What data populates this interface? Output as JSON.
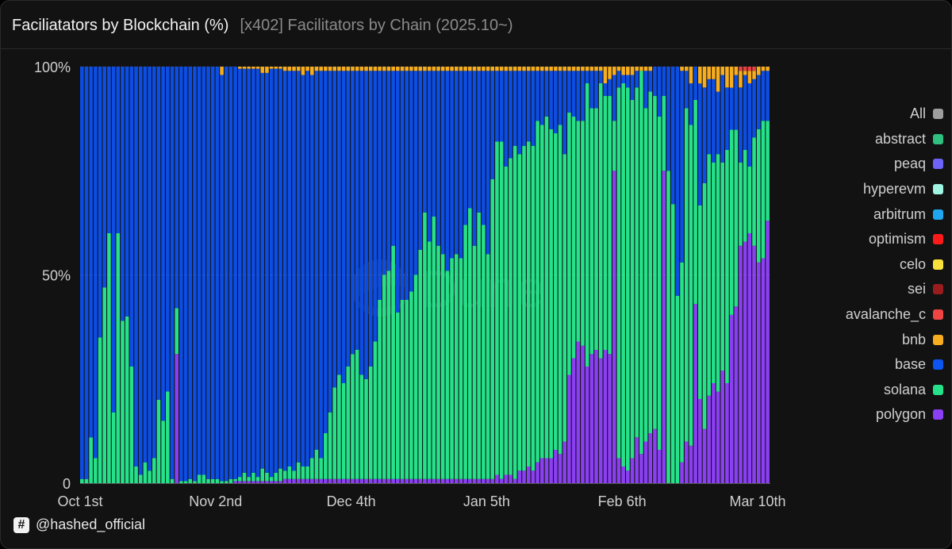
{
  "header": {
    "title": "Faciliatators by Blockchain (%)",
    "subtitle": "[x402] Facilitators by Chain (2025.10~)"
  },
  "footer": {
    "handle": "@hashed_official",
    "icon": "hash-icon"
  },
  "watermark": {
    "text": "Dune",
    "icon": "dune-logo-icon"
  },
  "colors": {
    "background": "#121212",
    "polygon": "#8b3ff2",
    "solana": "#25e28a",
    "base": "#0c4de3",
    "bnb": "#f6ad1f",
    "avalanche_c": "#e84142",
    "optimism": "#ff0420",
    "abstract": "#1bb37a"
  },
  "legend": {
    "items": [
      {
        "label": "All",
        "color": "#9e9e9e"
      },
      {
        "label": "abstract",
        "color": "#2fbf7f"
      },
      {
        "label": "peaq",
        "color": "#6d63f6"
      },
      {
        "label": "hyperevm",
        "color": "#9ff5e1"
      },
      {
        "label": "arbitrum",
        "color": "#1fa6ee"
      },
      {
        "label": "optimism",
        "color": "#ff1a1a"
      },
      {
        "label": "celo",
        "color": "#f7e13a"
      },
      {
        "label": "sei",
        "color": "#9b1c1c"
      },
      {
        "label": "avalanche_c",
        "color": "#ef4444"
      },
      {
        "label": "bnb",
        "color": "#f6ad1f"
      },
      {
        "label": "base",
        "color": "#0c55ee"
      },
      {
        "label": "solana",
        "color": "#25e28a"
      },
      {
        "label": "polygon",
        "color": "#8b3ff2"
      }
    ]
  },
  "chart_data": {
    "type": "bar",
    "stacked": true,
    "normalized": true,
    "x_start": "2025-10-01",
    "x_end": "2026-03-13",
    "x_ticks": [
      {
        "date": "2025-10-01",
        "label": "Oct 1st"
      },
      {
        "date": "2025-11-02",
        "label": "Nov 2nd"
      },
      {
        "date": "2025-12-04",
        "label": "Dec 4th"
      },
      {
        "date": "2026-01-05",
        "label": "Jan 5th"
      },
      {
        "date": "2026-02-06",
        "label": "Feb 6th"
      },
      {
        "date": "2026-03-10",
        "label": "Mar 10th"
      }
    ],
    "y_ticks": [
      {
        "value": 0,
        "label": "0"
      },
      {
        "value": 50,
        "label": "50%"
      },
      {
        "value": 100,
        "label": "100%"
      }
    ],
    "ylim": [
      0,
      100
    ],
    "series_order": [
      "polygon",
      "solana",
      "base",
      "bnb",
      "avalanche_c"
    ],
    "series_colors": [
      "#8b3ff2",
      "#25e28a",
      "#0c4de3",
      "#f6ad1f",
      "#e84142"
    ],
    "points": [
      [
        0,
        0,
        1,
        99,
        0,
        0
      ],
      [
        1,
        0,
        1,
        99,
        0,
        0
      ],
      [
        2,
        0,
        11,
        89,
        0,
        0
      ],
      [
        3,
        0,
        6,
        94,
        0,
        0
      ],
      [
        4,
        0,
        35,
        65,
        0,
        0
      ],
      [
        5,
        0,
        47,
        53,
        0,
        0
      ],
      [
        6,
        0,
        60,
        40,
        0,
        0
      ],
      [
        7,
        0,
        17,
        83,
        0,
        0
      ],
      [
        8,
        0,
        60,
        40,
        0,
        0
      ],
      [
        9,
        0,
        39,
        61,
        0,
        0
      ],
      [
        10,
        0,
        40,
        60,
        0,
        0
      ],
      [
        11,
        0,
        28,
        72,
        0,
        0
      ],
      [
        12,
        0,
        4,
        96,
        0,
        0
      ],
      [
        13,
        0,
        2,
        98,
        0,
        0
      ],
      [
        14,
        0,
        5,
        95,
        0,
        0
      ],
      [
        15,
        0,
        3,
        97,
        0,
        0
      ],
      [
        16,
        0,
        6,
        94,
        0,
        0
      ],
      [
        17,
        0,
        20,
        80,
        0,
        0
      ],
      [
        18,
        0,
        15,
        85,
        0,
        0
      ],
      [
        19,
        0,
        22,
        78,
        0,
        0
      ],
      [
        20,
        0,
        1,
        99,
        0,
        0
      ],
      [
        21,
        31,
        11,
        58,
        0,
        0
      ],
      [
        22,
        0,
        0.5,
        99,
        0,
        0
      ],
      [
        23,
        0,
        0.5,
        99,
        0,
        0
      ],
      [
        24,
        0,
        1,
        99,
        0,
        0
      ],
      [
        25,
        0,
        0.5,
        99,
        0,
        0
      ],
      [
        26,
        0,
        2,
        98,
        0,
        0
      ],
      [
        27,
        0,
        2,
        98,
        0,
        0
      ],
      [
        28,
        0,
        1,
        99,
        0,
        0
      ],
      [
        29,
        0,
        1,
        99,
        0,
        0
      ],
      [
        30,
        0,
        1,
        99,
        0,
        0
      ],
      [
        31,
        0,
        0.5,
        98,
        2,
        0
      ],
      [
        32,
        0,
        0.5,
        99,
        0,
        0
      ],
      [
        33,
        0,
        1,
        99,
        0,
        0
      ],
      [
        34,
        0.5,
        0.5,
        99,
        0,
        0
      ],
      [
        35,
        0.5,
        1,
        98,
        0.5,
        0
      ],
      [
        36,
        0.5,
        2,
        97,
        0.5,
        0
      ],
      [
        37,
        0.5,
        1,
        98,
        0.5,
        0
      ],
      [
        38,
        0.5,
        2,
        97,
        0.5,
        0
      ],
      [
        39,
        0.5,
        1,
        98,
        0.5,
        0
      ],
      [
        40,
        0.5,
        3,
        95,
        1.5,
        0
      ],
      [
        41,
        0.5,
        2,
        96,
        1.5,
        0
      ],
      [
        42,
        0.5,
        1,
        98,
        0.5,
        0
      ],
      [
        43,
        0.5,
        2,
        97,
        0.5,
        0
      ],
      [
        44,
        0.5,
        3,
        96,
        0.5,
        0
      ],
      [
        45,
        1,
        2,
        96,
        1,
        0
      ],
      [
        46,
        1,
        3,
        95,
        1,
        0
      ],
      [
        47,
        1,
        2,
        96,
        1,
        0
      ],
      [
        48,
        1,
        4,
        94,
        1,
        0
      ],
      [
        49,
        1,
        3,
        94,
        2,
        0
      ],
      [
        50,
        1,
        3,
        95,
        1,
        0
      ],
      [
        51,
        1,
        5,
        92,
        2,
        0
      ],
      [
        52,
        1,
        7,
        91,
        1,
        0
      ],
      [
        53,
        1,
        5,
        93,
        1,
        0
      ],
      [
        54,
        1,
        11,
        87,
        1,
        0
      ],
      [
        55,
        1,
        16,
        82,
        1,
        0
      ],
      [
        56,
        1,
        22,
        76,
        1,
        0
      ],
      [
        57,
        1,
        25,
        73,
        1,
        0
      ],
      [
        58,
        1,
        23,
        75,
        1,
        0
      ],
      [
        59,
        1,
        27,
        71,
        1,
        0
      ],
      [
        60,
        1,
        30,
        68,
        1,
        0
      ],
      [
        61,
        1,
        31,
        67,
        1,
        0
      ],
      [
        62,
        1,
        25,
        73,
        1,
        0
      ],
      [
        63,
        1,
        24,
        74,
        1,
        0
      ],
      [
        64,
        1,
        27,
        71,
        1,
        0
      ],
      [
        65,
        1,
        33,
        65,
        1,
        0
      ],
      [
        66,
        1,
        43,
        55,
        1,
        0
      ],
      [
        67,
        1,
        49,
        49,
        1,
        0
      ],
      [
        68,
        1,
        50,
        48,
        1,
        0
      ],
      [
        69,
        1,
        56,
        42,
        1,
        0
      ],
      [
        70,
        1,
        40,
        58,
        1,
        0
      ],
      [
        71,
        1,
        43,
        55,
        1,
        0
      ],
      [
        72,
        1,
        43,
        55,
        1,
        0
      ],
      [
        73,
        1,
        45,
        53,
        1,
        0
      ],
      [
        74,
        1,
        49,
        49,
        1,
        0
      ],
      [
        75,
        1,
        55,
        43,
        1,
        0
      ],
      [
        76,
        1,
        64,
        34,
        1,
        0
      ],
      [
        77,
        1,
        57,
        41,
        1,
        0
      ],
      [
        78,
        1,
        63,
        35,
        1,
        0
      ],
      [
        79,
        1,
        56,
        42,
        1,
        0
      ],
      [
        80,
        1,
        54,
        44,
        1,
        0
      ],
      [
        81,
        1,
        50,
        48,
        1,
        0
      ],
      [
        82,
        1,
        53,
        45,
        1,
        0
      ],
      [
        83,
        1,
        54,
        44,
        1,
        0
      ],
      [
        84,
        1,
        53,
        45,
        1,
        0
      ],
      [
        85,
        1,
        61,
        37,
        1,
        0
      ],
      [
        86,
        1,
        65,
        33,
        1,
        0
      ],
      [
        87,
        1,
        56,
        42,
        1,
        0
      ],
      [
        88,
        1,
        64,
        34,
        1,
        0
      ],
      [
        89,
        1,
        61,
        37,
        1,
        0
      ],
      [
        90,
        1,
        54,
        44,
        1,
        0
      ],
      [
        91,
        1,
        72,
        26,
        1,
        0
      ],
      [
        92,
        2,
        80,
        17,
        1,
        0
      ],
      [
        93,
        1,
        81,
        17,
        1,
        0
      ],
      [
        94,
        2,
        74,
        23,
        1,
        0
      ],
      [
        95,
        2,
        76,
        21,
        1,
        0
      ],
      [
        96,
        1,
        80,
        18,
        1,
        0
      ],
      [
        97,
        3,
        76,
        20,
        1,
        0
      ],
      [
        98,
        3,
        78,
        18,
        1,
        0
      ],
      [
        99,
        4,
        78,
        17,
        1,
        0
      ],
      [
        100,
        3,
        78,
        18,
        1,
        0
      ],
      [
        101,
        5,
        82,
        12,
        1,
        0
      ],
      [
        102,
        6,
        80,
        13,
        1,
        0
      ],
      [
        103,
        6,
        82,
        11,
        1,
        0
      ],
      [
        104,
        6,
        79,
        14,
        1,
        0
      ],
      [
        105,
        8,
        76,
        15,
        1,
        0
      ],
      [
        106,
        7,
        79,
        13,
        1,
        0
      ],
      [
        107,
        10,
        69,
        20,
        1,
        0
      ],
      [
        108,
        26,
        63,
        10,
        1,
        0
      ],
      [
        109,
        30,
        58,
        11,
        1,
        0
      ],
      [
        110,
        34,
        53,
        12,
        1,
        0
      ],
      [
        111,
        33,
        54,
        12,
        1,
        0
      ],
      [
        112,
        28,
        68,
        3,
        1,
        0
      ],
      [
        113,
        31,
        59,
        9,
        1,
        0
      ],
      [
        114,
        32,
        58,
        9,
        1,
        0
      ],
      [
        115,
        30,
        66,
        3,
        1,
        0
      ],
      [
        116,
        32,
        61,
        3,
        4,
        0
      ],
      [
        117,
        31,
        62,
        4,
        3,
        0
      ],
      [
        118,
        75,
        12,
        11,
        2,
        0
      ],
      [
        119,
        6,
        89,
        4,
        1,
        0
      ],
      [
        120,
        4,
        92,
        2,
        2,
        0
      ],
      [
        121,
        3,
        92,
        3,
        2,
        0
      ],
      [
        122,
        6,
        86,
        6,
        2,
        0
      ],
      [
        123,
        11,
        84,
        4,
        1,
        0
      ],
      [
        124,
        7,
        92,
        0,
        1,
        0
      ],
      [
        125,
        10,
        80,
        9,
        1,
        0
      ],
      [
        126,
        12,
        82,
        5,
        1,
        0
      ],
      [
        127,
        13,
        80,
        7,
        0,
        0
      ],
      [
        128,
        8,
        80,
        12,
        0,
        0
      ],
      [
        129,
        75,
        18,
        7,
        0,
        0
      ],
      [
        130,
        0,
        75,
        25,
        0,
        0
      ],
      [
        131,
        0,
        67,
        33,
        0,
        0
      ],
      [
        132,
        0,
        45,
        55,
        0,
        0
      ],
      [
        133,
        5,
        48,
        46,
        1,
        0
      ],
      [
        134,
        10,
        80,
        9,
        1,
        0
      ],
      [
        135,
        9,
        77,
        10,
        4,
        0
      ],
      [
        136,
        43,
        49,
        8,
        0,
        0
      ],
      [
        137,
        20,
        46,
        29,
        4,
        0
      ],
      [
        138,
        13,
        59,
        23,
        5,
        0
      ],
      [
        139,
        21,
        58,
        18,
        3,
        0
      ],
      [
        140,
        24,
        53,
        20,
        3,
        0
      ],
      [
        141,
        22,
        57,
        15,
        6,
        0
      ],
      [
        142,
        27,
        50,
        21,
        2,
        0
      ],
      [
        143,
        24,
        56,
        15,
        5,
        0
      ],
      [
        144,
        40,
        44,
        10,
        5,
        0
      ],
      [
        145,
        42,
        42,
        13,
        2,
        0
      ],
      [
        146,
        57,
        20,
        18,
        4,
        1
      ],
      [
        147,
        58,
        22,
        18,
        1,
        1
      ],
      [
        148,
        60,
        16,
        20,
        3,
        1
      ],
      [
        149,
        57,
        26,
        14,
        2,
        1
      ],
      [
        150,
        53,
        32,
        13,
        2,
        0
      ],
      [
        151,
        54,
        33,
        12,
        1,
        0
      ],
      [
        152,
        63,
        24,
        12,
        1,
        0
      ]
    ]
  }
}
